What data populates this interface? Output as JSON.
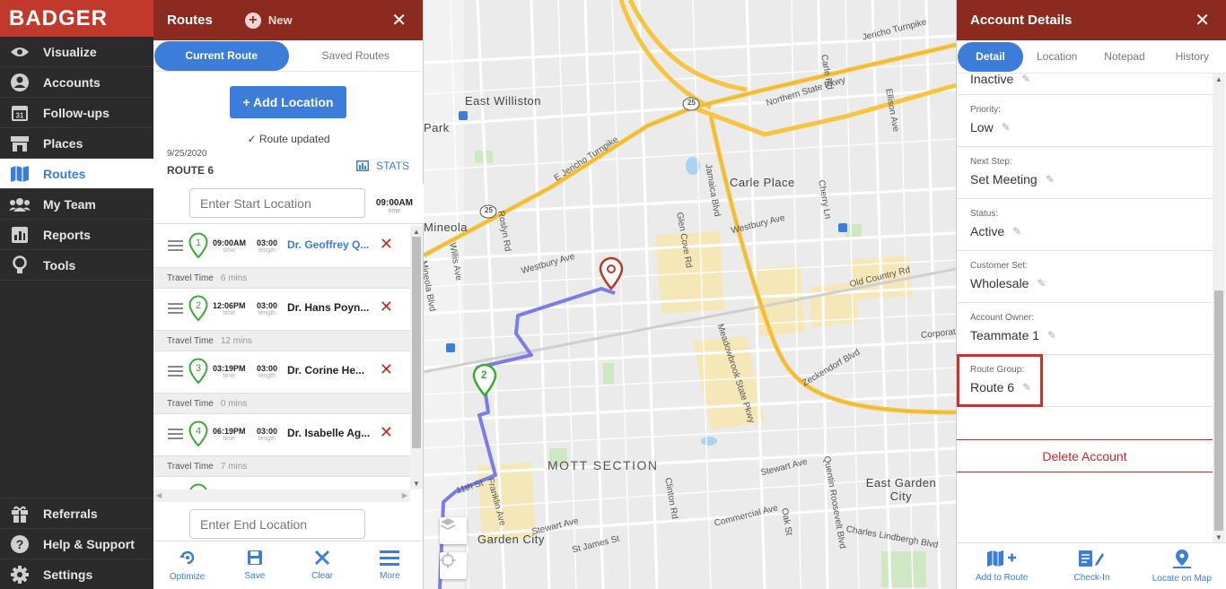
{
  "brand": {
    "name": "BADGER",
    "accent": "#c0392b",
    "panel_header": "#8b2a1e",
    "primary": "#3b7dd8",
    "danger": "#c62828"
  },
  "nav": {
    "items": [
      {
        "label": "Visualize",
        "icon": "eye-icon"
      },
      {
        "label": "Accounts",
        "icon": "user-circle-icon"
      },
      {
        "label": "Follow-ups",
        "icon": "calendar-icon"
      },
      {
        "label": "Places",
        "icon": "store-icon"
      },
      {
        "label": "Routes",
        "icon": "map-icon",
        "active": true
      },
      {
        "label": "My Team",
        "icon": "team-icon"
      },
      {
        "label": "Reports",
        "icon": "report-icon"
      },
      {
        "label": "Tools",
        "icon": "lightbulb-icon"
      }
    ],
    "bottom": [
      {
        "label": "Referrals",
        "icon": "gift-icon"
      },
      {
        "label": "Help & Support",
        "icon": "help-icon"
      },
      {
        "label": "Settings",
        "icon": "gear-icon"
      }
    ]
  },
  "routes": {
    "title": "Routes",
    "new_label": "New",
    "tabs": [
      "Current Route",
      "Saved Routes"
    ],
    "add_location": "+ Add Location",
    "status": "Route updated",
    "date": "9/25/2020",
    "route_name": "ROUTE 6",
    "stats": "STATS",
    "start_placeholder": "Enter Start Location",
    "start_time": "09:00AM",
    "time_caption": "time",
    "length_caption": "length",
    "end_placeholder": "Enter End Location",
    "stops": [
      {
        "num": "1",
        "time": "09:00AM",
        "length": "03:00",
        "name": "Dr. Geoffrey Q...",
        "link": true,
        "travel": "6 mins"
      },
      {
        "num": "2",
        "time": "12:06PM",
        "length": "03:00",
        "name": "Dr. Hans Poyn...",
        "link": false,
        "travel": "12 mins"
      },
      {
        "num": "3",
        "time": "03:19PM",
        "length": "03:00",
        "name": "Dr. Corine He...",
        "link": false,
        "travel": "0 mins"
      },
      {
        "num": "4",
        "time": "06:19PM",
        "length": "03:00",
        "name": "Dr. Isabelle Ag...",
        "link": false,
        "travel": "7 mins"
      }
    ],
    "travel_label": "Travel Time",
    "toolbar": [
      "Optimize",
      "Save",
      "Clear",
      "More"
    ]
  },
  "map": {
    "labels": {
      "east_williston": "East Williston",
      "park": "Park",
      "mineola": "Mineola",
      "carle_place": "Carle Place",
      "mott_section": "MOTT SECTION",
      "garden_city": "Garden City",
      "east_garden_city": "East Garden City",
      "jericho_tpke": "Jericho Turnpike",
      "e_jericho_tpke": "E Jericho Turnpike",
      "northern_state": "Northern State Pkwy",
      "meadowbrook": "Meadowbrook State Pkwy",
      "westbury_ave": "Westbury Ave",
      "westbury_ave_2": "Westbury Ave",
      "old_country": "Old Country Rd",
      "zeckendorf": "Zeckendorf Blvd",
      "stewart_ave": "Stewart Ave",
      "stewart_ave_2": "Stewart Ave",
      "commercial_ave": "Commercial Ave",
      "st_james": "St James St",
      "charles_lindbergh": "Charles Lindbergh Blvd",
      "franklin_ave": "Franklin Ave",
      "eleventh_st": "11th St",
      "jamaica_blvd": "Jamaica Blvd",
      "glen_cove_rd": "Glen Cove Rd",
      "roslyn_rd": "Roslyn Rd",
      "willis_ave": "Willis Ave",
      "mineola_blvd": "Mineola Blvd",
      "carle_rd": "Carle Rd",
      "ellison_ave": "Ellison Ave",
      "cherry_ln": "Cherry Ln",
      "clinton_rd": "Clinton Rd",
      "oak_st": "Oak St",
      "quentin_roosevelt": "Quentin Roosevelt Blvd",
      "corporate": "Corporat",
      "route_25a": "25",
      "route_25b": "25",
      "marker_2": "2"
    }
  },
  "account": {
    "title": "Account Details",
    "tabs": [
      "Detail",
      "Location",
      "Notepad",
      "History"
    ],
    "fields": [
      {
        "label": "",
        "value": "Inactive"
      },
      {
        "label": "Priority:",
        "value": "Low"
      },
      {
        "label": "Next Step:",
        "value": "Set Meeting"
      },
      {
        "label": "Status:",
        "value": "Active"
      },
      {
        "label": "Customer Set:",
        "value": "Wholesale"
      },
      {
        "label": "Account Owner:",
        "value": "Teammate 1"
      },
      {
        "label": "Route Group:",
        "value": "Route 6"
      }
    ],
    "delete": "Delete Account",
    "toolbar": [
      "Add to Route",
      "Check-In",
      "Locate on Map"
    ]
  }
}
